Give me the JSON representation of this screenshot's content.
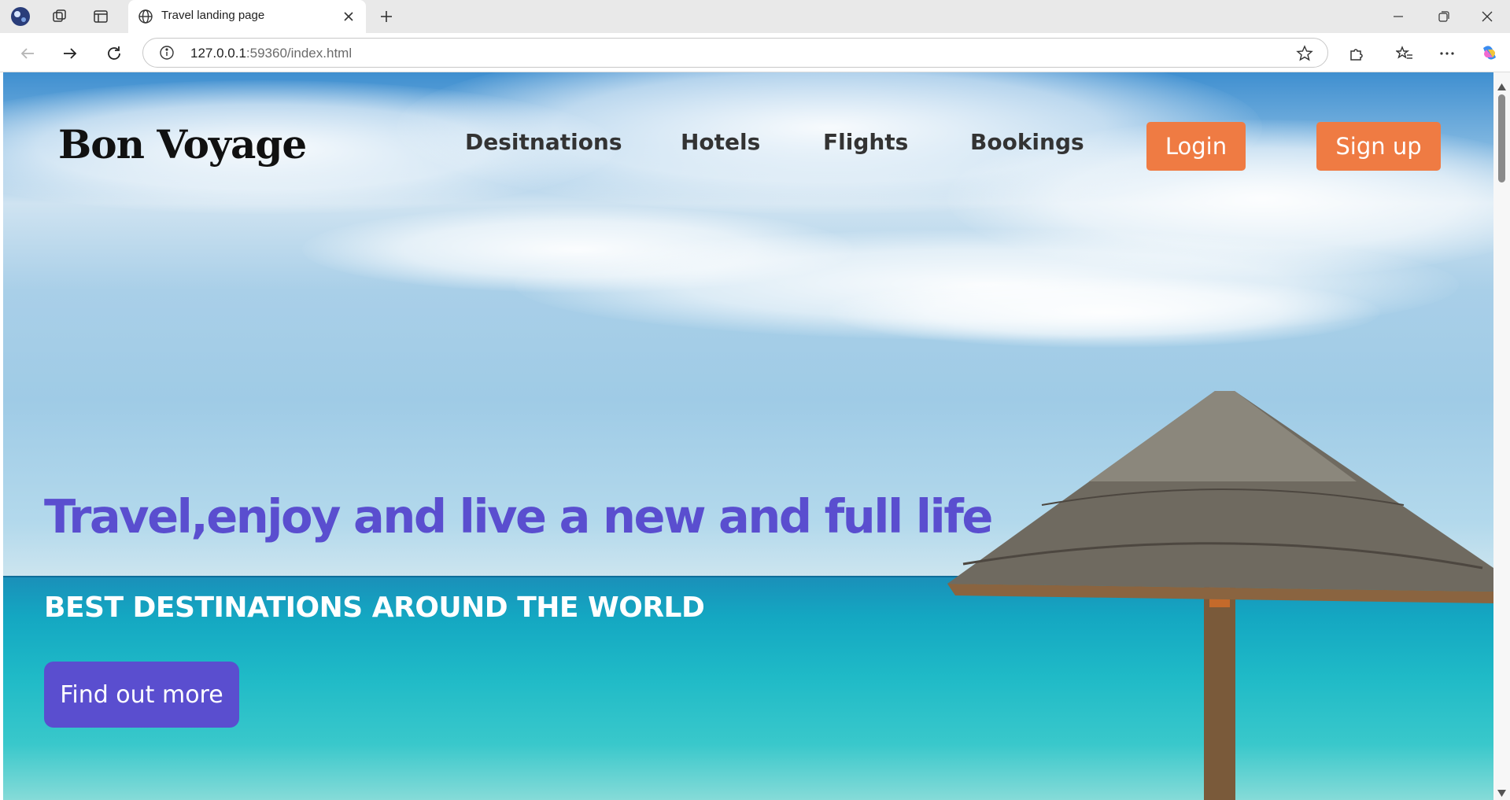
{
  "browser": {
    "tab_title": "Travel landing page",
    "url_host": "127.0.0.1",
    "url_rest": ":59360/index.html"
  },
  "site": {
    "logo": "Bon Voyage",
    "nav": [
      "Desitnations",
      "Hotels",
      "Flights",
      "Bookings"
    ],
    "login_label": "Login",
    "signup_label": "Sign up",
    "accent_orange": "#ef7b43",
    "accent_purple": "#5a4ecf"
  },
  "hero": {
    "title": "Travel,enjoy and live a new and full life",
    "subtitle": "BEST DESTINATIONS AROUND THE WORLD",
    "cta_label": "Find out more"
  }
}
